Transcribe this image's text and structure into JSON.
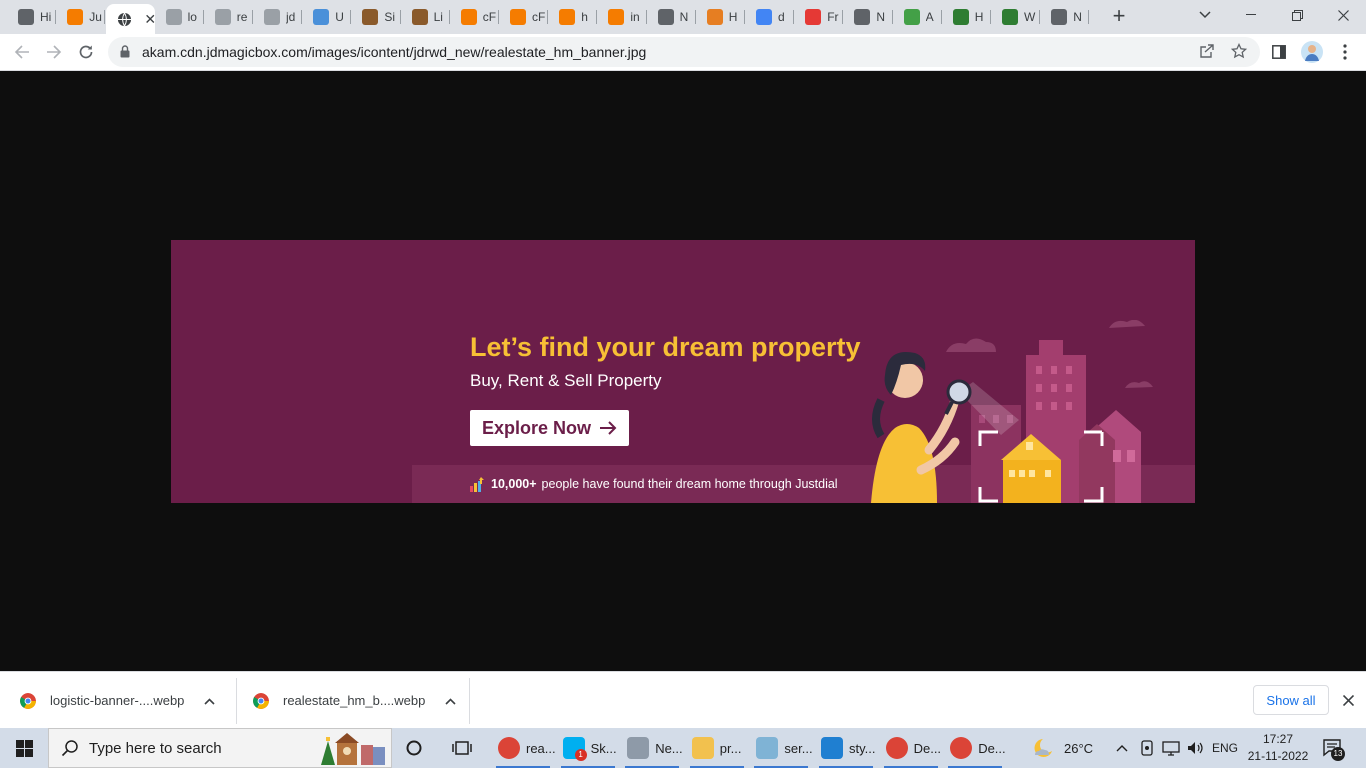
{
  "browser": {
    "tabs": [
      {
        "title": "Hi",
        "icon": "history-icon",
        "color": "#5f6368"
      },
      {
        "title": "Ju",
        "icon": "justdial-icon",
        "color": "#f57c00"
      },
      {
        "title": "",
        "icon": "globe-icon",
        "color": "#3c4043",
        "active": true
      },
      {
        "title": "lo",
        "icon": "globe-icon",
        "color": "#9aa0a6"
      },
      {
        "title": "re",
        "icon": "globe-icon",
        "color": "#9aa0a6"
      },
      {
        "title": "jd",
        "icon": "globe-icon",
        "color": "#9aa0a6"
      },
      {
        "title": "U",
        "icon": "plus-icon",
        "color": "#4a90d9"
      },
      {
        "title": "Si",
        "icon": "brand-icon",
        "color": "#8a5a2b"
      },
      {
        "title": "Li",
        "icon": "brand-icon",
        "color": "#8a5a2b"
      },
      {
        "title": "cF",
        "icon": "link-icon",
        "color": "#f57c00"
      },
      {
        "title": "cF",
        "icon": "link-icon",
        "color": "#f57c00"
      },
      {
        "title": "h",
        "icon": "link-icon",
        "color": "#f57c00"
      },
      {
        "title": "in",
        "icon": "link-icon",
        "color": "#f57c00"
      },
      {
        "title": "N",
        "icon": "github-icon",
        "color": "#5f6368"
      },
      {
        "title": "H",
        "icon": "pen-icon",
        "color": "#e67e22"
      },
      {
        "title": "d",
        "icon": "google-icon",
        "color": "#4285f4"
      },
      {
        "title": "Fr",
        "icon": "brand-icon",
        "color": "#e53935"
      },
      {
        "title": "N",
        "icon": "github-icon",
        "color": "#5f6368"
      },
      {
        "title": "A",
        "icon": "house-icon",
        "color": "#43a047"
      },
      {
        "title": "H",
        "icon": "w-icon",
        "color": "#2e7d32"
      },
      {
        "title": "W",
        "icon": "w-icon",
        "color": "#2e7d32"
      },
      {
        "title": "N",
        "icon": "github-icon",
        "color": "#5f6368"
      }
    ],
    "url": "akam.cdn.jdmagicbox.com/images/icontent/jdrwd_new/realestate_hm_banner.jpg"
  },
  "banner": {
    "headline": "Let’s find your dream property",
    "subline": "Buy, Rent & Sell Property",
    "cta_label": "Explore Now",
    "proof_count": "10,000+",
    "proof_text": "people have found their dream home through Justdial",
    "colors": {
      "background": "#6b1e49",
      "accent": "#f7c035"
    }
  },
  "downloads": {
    "items": [
      {
        "name": "logistic-banner-....webp"
      },
      {
        "name": "realestate_hm_b....webp"
      }
    ],
    "show_all": "Show all"
  },
  "taskbar": {
    "search_placeholder": "Type here to search",
    "apps": [
      {
        "label": "rea...",
        "icon": "chrome-icon"
      },
      {
        "label": "Sk...",
        "icon": "skype-icon",
        "badge": "1"
      },
      {
        "label": "Ne...",
        "icon": "drive-icon"
      },
      {
        "label": "pr...",
        "icon": "folder-icon"
      },
      {
        "label": "ser...",
        "icon": "editor-icon"
      },
      {
        "label": "sty...",
        "icon": "vscode-icon"
      },
      {
        "label": "De...",
        "icon": "chrome-icon"
      },
      {
        "label": "De...",
        "icon": "chrome-icon"
      }
    ],
    "weather": "26°C",
    "language": "ENG",
    "time": "17:27",
    "date": "21-11-2022",
    "notification_count": "13"
  }
}
